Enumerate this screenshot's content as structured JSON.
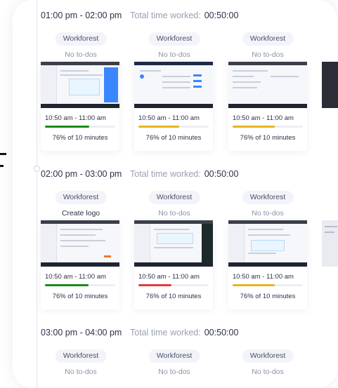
{
  "colors": {
    "activity_green": "#1a8a1a",
    "activity_yellow": "#e6b422",
    "activity_red": "#e23b3b"
  },
  "hours": [
    {
      "range": "01:00 pm - 02:00 pm",
      "total_label": "Total time worked:",
      "total_value": "00:50:00",
      "slots": [
        {
          "project": "Workforest",
          "todo": "No to-dos",
          "time": "10:50 am - 11:00 am",
          "activity": "76% of 10 minutes",
          "activity_fraction": 0.63,
          "activity_color": "#1a8a1a"
        },
        {
          "project": "Workforest",
          "todo": "No to-dos",
          "time": "10:50 am - 11:00 am",
          "activity": "76% of 10 minutes",
          "activity_fraction": 0.58,
          "activity_color": "#e6b422"
        },
        {
          "project": "Workforest",
          "todo": "No to-dos",
          "time": "10:50 am - 11:00 am",
          "activity": "76% of 10 minutes",
          "activity_fraction": 0.6,
          "activity_color": "#e6b422"
        }
      ]
    },
    {
      "range": "02:00 pm - 03:00 pm",
      "total_label": "Total time worked:",
      "total_value": "00:50:00",
      "slots": [
        {
          "project": "Workforest",
          "todo": "Create logo",
          "time": "10:50 am - 11:00 am",
          "activity": "76% of 10 minutes",
          "activity_fraction": 0.62,
          "activity_color": "#1a8a1a"
        },
        {
          "project": "Workforest",
          "todo": "No to-dos",
          "time": "10:50 am - 11:00 am",
          "activity": "76% of 10 minutes",
          "activity_fraction": 0.47,
          "activity_color": "#e23b3b"
        },
        {
          "project": "Workforest",
          "todo": "No to-dos",
          "time": "10:50 am - 11:00 am",
          "activity": "76% of 10 minutes",
          "activity_fraction": 0.6,
          "activity_color": "#e6b422"
        }
      ]
    },
    {
      "range": "03:00 pm - 04:00 pm",
      "total_label": "Total time worked:",
      "total_value": "00:50:00",
      "slots": [
        {
          "project": "Workforest",
          "todo": "No to-dos"
        },
        {
          "project": "Workforest",
          "todo": "No to-dos"
        },
        {
          "project": "Workforest",
          "todo": "No to-dos"
        }
      ]
    }
  ]
}
